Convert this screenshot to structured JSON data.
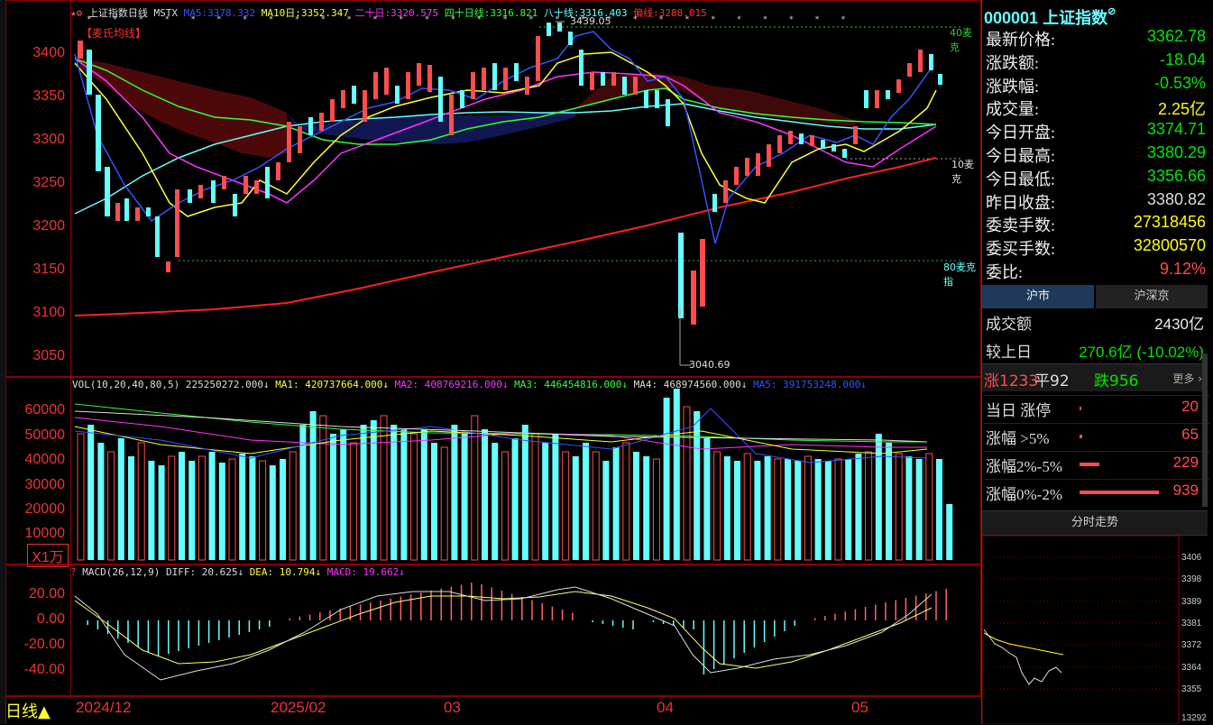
{
  "main_legend": {
    "title": "上证指数日线",
    "indicator": "MSTX",
    "ma5_label": "MA5:",
    "ma5_value": "3378.332",
    "ma10_label": "MA10日:",
    "ma10_value": "3352.347",
    "ma20_label": "二十日:",
    "ma20_value": "3320.575",
    "ma40_label": "四十日线:",
    "ma40_value": "3316.821",
    "ma80_label": "八十线:",
    "ma80_value": "3316.403",
    "bias_label": "偏线:",
    "bias_value": "3288.015",
    "badge": "【麦氏均线】"
  },
  "price_axis": [
    "3400",
    "3350",
    "3300",
    "3250",
    "3200",
    "3150",
    "3100",
    "3050"
  ],
  "annotations": {
    "high": "3439.05",
    "low": "3040.69",
    "mk40": "40麦克",
    "mk10": "10麦克",
    "mk80": "80麦克指"
  },
  "vol_legend": {
    "title": "VOL(10,20,40,80,5)",
    "vol": "225250272.000↓",
    "ma1": "MA1: 420737664.000↓",
    "ma2": "MA2: 408769216.000↓",
    "ma3": "MA3: 446454816.000↓",
    "ma4": "MA4: 468974560.000↓",
    "ma5": "MA5: 391753248.000↓"
  },
  "vol_axis": [
    "60000",
    "50000",
    "40000",
    "30000",
    "20000",
    "10000"
  ],
  "vol_unit": "X1万",
  "macd_legend": {
    "title": "MACD(26,12,9)",
    "diff": "DIFF: 20.625↓",
    "dea": "DEA: 10.794↓",
    "macd": "MACD: 19.662↓"
  },
  "macd_axis": [
    "20.00",
    "0.00",
    "-20.00",
    "-40.00"
  ],
  "period_label": "日线▲",
  "x_axis": [
    "2024/12",
    "2025/02",
    "03",
    "04",
    "05"
  ],
  "quote": {
    "code_name": "000001 上证指数",
    "rows": [
      {
        "k": "最新价格:",
        "v": "3362.78",
        "c": "#00e600"
      },
      {
        "k": "涨跌额:",
        "v": "-18.04",
        "c": "#00e600"
      },
      {
        "k": "涨跌幅:",
        "v": "-0.53%",
        "c": "#00e600"
      },
      {
        "k": "成交量:",
        "v": "2.25亿",
        "c": "#ffff00"
      },
      {
        "k": "今日开盘:",
        "v": "3374.71",
        "c": "#00e600"
      },
      {
        "k": "今日最高:",
        "v": "3380.29",
        "c": "#00e600"
      },
      {
        "k": "今日最低:",
        "v": "3356.66",
        "c": "#00e600"
      },
      {
        "k": "昨日收盘:",
        "v": "3380.82",
        "c": "#dddddd"
      },
      {
        "k": "委卖手数:",
        "v": "27318456",
        "c": "#ffff00"
      },
      {
        "k": "委买手数:",
        "v": "32800570",
        "c": "#ffff00"
      },
      {
        "k": "委比:",
        "v": "9.12%",
        "c": "#ff4d4d"
      }
    ]
  },
  "tabs": [
    "沪市",
    "沪深京"
  ],
  "turnover": {
    "k": "成交额",
    "v": "2430亿"
  },
  "vs_prev": {
    "k": "较上日",
    "v": "270.6亿 (-10.02%)"
  },
  "breadth": {
    "up": "涨1233",
    "flat": "平92",
    "down": "跌956",
    "more": "更多 ›"
  },
  "limit_stats": [
    {
      "k": "当日 涨停",
      "v": "20",
      "bar": 0.01
    },
    {
      "k": "涨幅 >5%",
      "v": "65",
      "bar": 0.03
    },
    {
      "k": "涨幅2%-5%",
      "v": "229",
      "bar": 0.25
    },
    {
      "k": "涨幅0%-2%",
      "v": "939",
      "bar": 1.0
    }
  ],
  "intraday": {
    "title": "分时走势",
    "axis": [
      "3406",
      "3398",
      "3389",
      "3381",
      "3372",
      "3364",
      "3355",
      "13292"
    ]
  }
}
